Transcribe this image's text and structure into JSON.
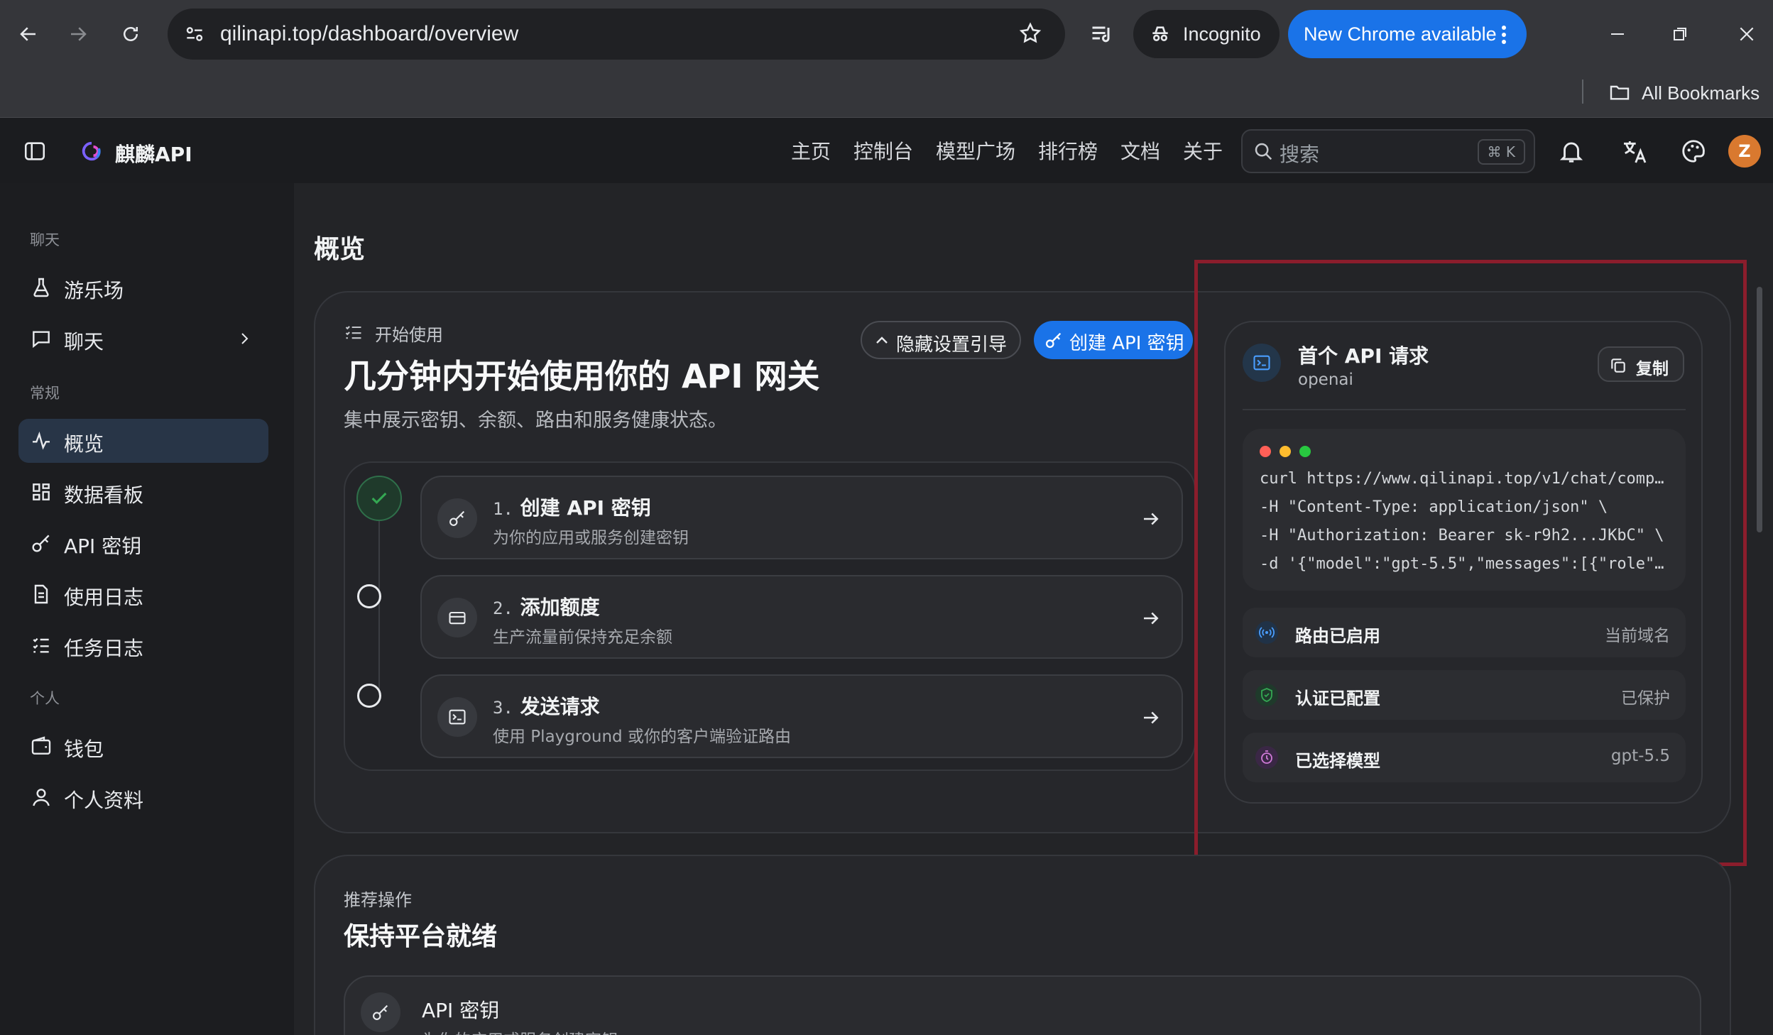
{
  "browser": {
    "url": "qilinapi.top/dashboard/overview",
    "incognito_label": "Incognito",
    "update_label": "New Chrome available",
    "bookmarks_label": "All Bookmarks"
  },
  "app": {
    "brand": "麒麟API",
    "nav": [
      "主页",
      "控制台",
      "模型广场",
      "排行榜",
      "文档",
      "关于"
    ],
    "search_placeholder": "搜索",
    "search_shortcut": "⌘ K",
    "avatar_letter": "Z"
  },
  "sidebar": {
    "sections": [
      {
        "title": "聊天",
        "items": [
          "游乐场",
          "聊天"
        ]
      },
      {
        "title": "常规",
        "items": [
          "概览",
          "数据看板",
          "API 密钥",
          "使用日志",
          "任务日志"
        ]
      },
      {
        "title": "个人",
        "items": [
          "钱包",
          "个人资料"
        ]
      }
    ],
    "active": "概览"
  },
  "page": {
    "title": "概览",
    "getting_started": {
      "eyebrow": "开始使用",
      "heading": "几分钟内开始使用你的 API 网关",
      "subtitle": "集中展示密钥、余额、路由和服务健康状态。",
      "hide_button": "隐藏设置引导",
      "create_button": "创建 API 密钥",
      "steps": [
        {
          "num": "1.",
          "title": "创建 API 密钥",
          "desc": "为你的应用或服务创建密钥",
          "done": true
        },
        {
          "num": "2.",
          "title": "添加额度",
          "desc": "生产流量前保持充足余额",
          "done": false
        },
        {
          "num": "3.",
          "title": "发送请求",
          "desc": "使用 Playground 或你的客户端验证路由",
          "done": false
        }
      ]
    },
    "first_request": {
      "title": "首个 API 请求",
      "provider": "openai",
      "copy_label": "复制",
      "code_lines": [
        "curl https://www.qilinapi.top/v1/chat/comp…",
        "-H \"Content-Type: application/json\" \\",
        "-H \"Authorization: Bearer sk-r9h2...JKbC\" \\",
        "-d '{\"model\":\"gpt-5.5\",\"messages\":[{\"role\"…"
      ],
      "status": [
        {
          "label": "路由已启用",
          "value": "当前域名"
        },
        {
          "label": "认证已配置",
          "value": "已保护"
        },
        {
          "label": "已选择模型",
          "value": "gpt-5.5"
        }
      ]
    },
    "recommended": {
      "eyebrow": "推荐操作",
      "heading": "保持平台就绪",
      "items": [
        {
          "title": "API 密钥",
          "desc": "为你的应用或服务创建密钥"
        }
      ]
    }
  },
  "colors": {
    "accent": "#1a73e8",
    "success": "#34a853",
    "highlight": "#8b1d2c"
  }
}
